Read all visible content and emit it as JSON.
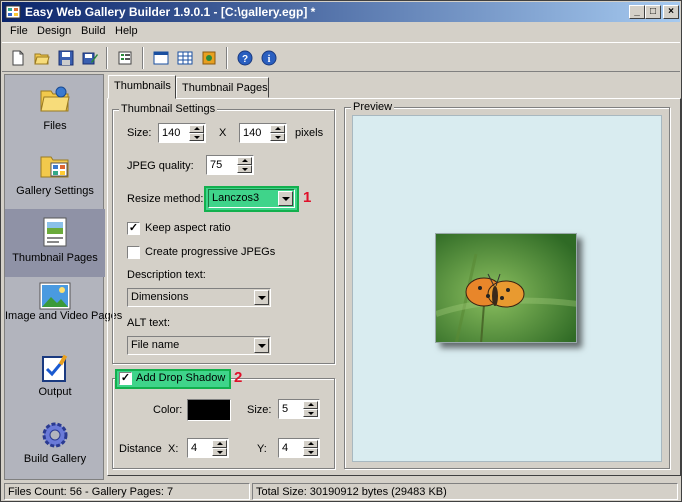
{
  "window": {
    "title": "Easy Web Gallery Builder 1.9.0.1 - [C:\\gallery.egp] *"
  },
  "menu": [
    "File",
    "Design",
    "Build",
    "Help"
  ],
  "sidebar": {
    "items": [
      {
        "label": "Files",
        "icon": "folder-icon"
      },
      {
        "label": "Gallery Settings",
        "icon": "gallery-settings-icon"
      },
      {
        "label": "Thumbnail Pages",
        "icon": "thumbnail-pages-icon",
        "selected": true
      },
      {
        "label": "Image and Video Pages",
        "icon": "image-video-pages-icon"
      },
      {
        "label": "Output",
        "icon": "output-icon"
      },
      {
        "label": "Build Gallery",
        "icon": "build-gallery-icon"
      }
    ]
  },
  "tabs": [
    {
      "label": "Thumbnails",
      "active": true
    },
    {
      "label": "Thumbnail Pages",
      "active": false
    }
  ],
  "thumbnail_settings": {
    "title": "Thumbnail Settings",
    "size_label": "Size:",
    "width": "140",
    "x_label": "X",
    "height": "140",
    "units": "pixels",
    "jpeg_quality_label": "JPEG quality:",
    "jpeg_quality": "75",
    "resize_method_label": "Resize method:",
    "resize_method": "Lanczos3",
    "keep_aspect_label": "Keep aspect ratio",
    "keep_aspect": true,
    "progressive_label": "Create progressive JPEGs",
    "progressive": false,
    "description_label": "Description text:",
    "description_value": "Dimensions",
    "alt_label": "ALT text:",
    "alt_value": "File name"
  },
  "drop_shadow": {
    "label": "Add Drop Shadow",
    "enabled": true,
    "color_label": "Color:",
    "color": "#000000",
    "size_label": "Size:",
    "size": "5",
    "distance_label": "Distance",
    "x_label": "X:",
    "x": "4",
    "y_label": "Y:",
    "y": "4"
  },
  "preview": {
    "title": "Preview"
  },
  "annotations": {
    "one": "1",
    "two": "2"
  },
  "status": {
    "files": "Files Count: 56 - Gallery Pages: 7",
    "size": "Total Size: 30190912 bytes (29483 KB)"
  },
  "colors": {
    "highlight": "#3fd48a",
    "badge": "#e0102a",
    "preview_bg": "#d9ecf0"
  }
}
